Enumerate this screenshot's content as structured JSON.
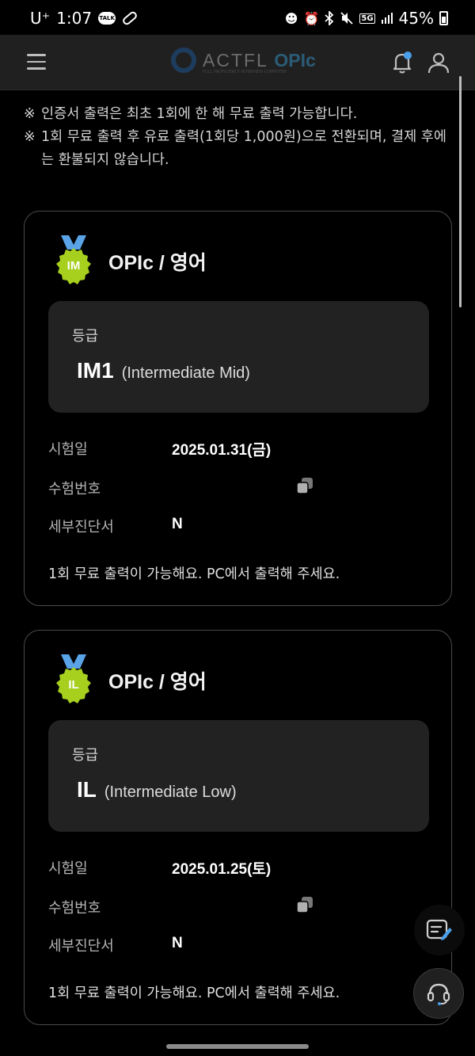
{
  "status_bar": {
    "carrier": "U⁺",
    "time": "1:07",
    "battery": "45%",
    "network": "5G",
    "icons": [
      "talk-icon",
      "pill-icon",
      "face-icon",
      "alarm-icon",
      "bluetooth-icon",
      "mute-icon",
      "signal-icon",
      "battery-icon"
    ]
  },
  "header": {
    "logo_text": "ACTFL",
    "logo_accent": "OPIc",
    "logo_sub": "FULL PROFICIENCY INTERVIEW COMPUTER",
    "icons": [
      "menu-icon",
      "bell-icon",
      "user-icon"
    ],
    "notification_dot_color": "#4a9fe8"
  },
  "notices": [
    {
      "mark": "※",
      "text": "인증서 출력은 최초 1회에 한 해 무료 출력 가능합니다."
    },
    {
      "mark": "※",
      "text": "1회 무료 출력 후 유료 출력(1회당 1,000원)으로 전환되며, 결제 후에는 환불되지 않습니다."
    }
  ],
  "certificates": [
    {
      "medal": "IM",
      "title": "OPIc / 영어",
      "grade_label": "등급",
      "grade_code": "IM1",
      "grade_desc": "(Intermediate Mid)",
      "exam_date_label": "시험일",
      "exam_date": "2025.01.31(금)",
      "exam_number_label": "수험번호",
      "exam_number": "",
      "detail_label": "세부진단서",
      "detail_value": "N",
      "note": "1회 무료 출력이 가능해요. PC에서 출력해 주세요."
    },
    {
      "medal": "IL",
      "title": "OPIc / 영어",
      "grade_label": "등급",
      "grade_code": "IL",
      "grade_desc": "(Intermediate Low)",
      "exam_date_label": "시험일",
      "exam_date": "2025.01.25(토)",
      "exam_number_label": "수험번호",
      "exam_number": "",
      "detail_label": "세부진단서",
      "detail_value": "N",
      "note": "1회 무료 출력이 가능해요. PC에서 출력해 주세요."
    }
  ],
  "colors": {
    "background": "#000000",
    "header": "#202020",
    "card_border": "#4a4a4a",
    "grade_box": "#222222",
    "medal_green": "#a6cf1e",
    "ribbon_blue": "#5aa3e6"
  },
  "fabs": [
    "edit-note-icon",
    "headset-icon"
  ]
}
